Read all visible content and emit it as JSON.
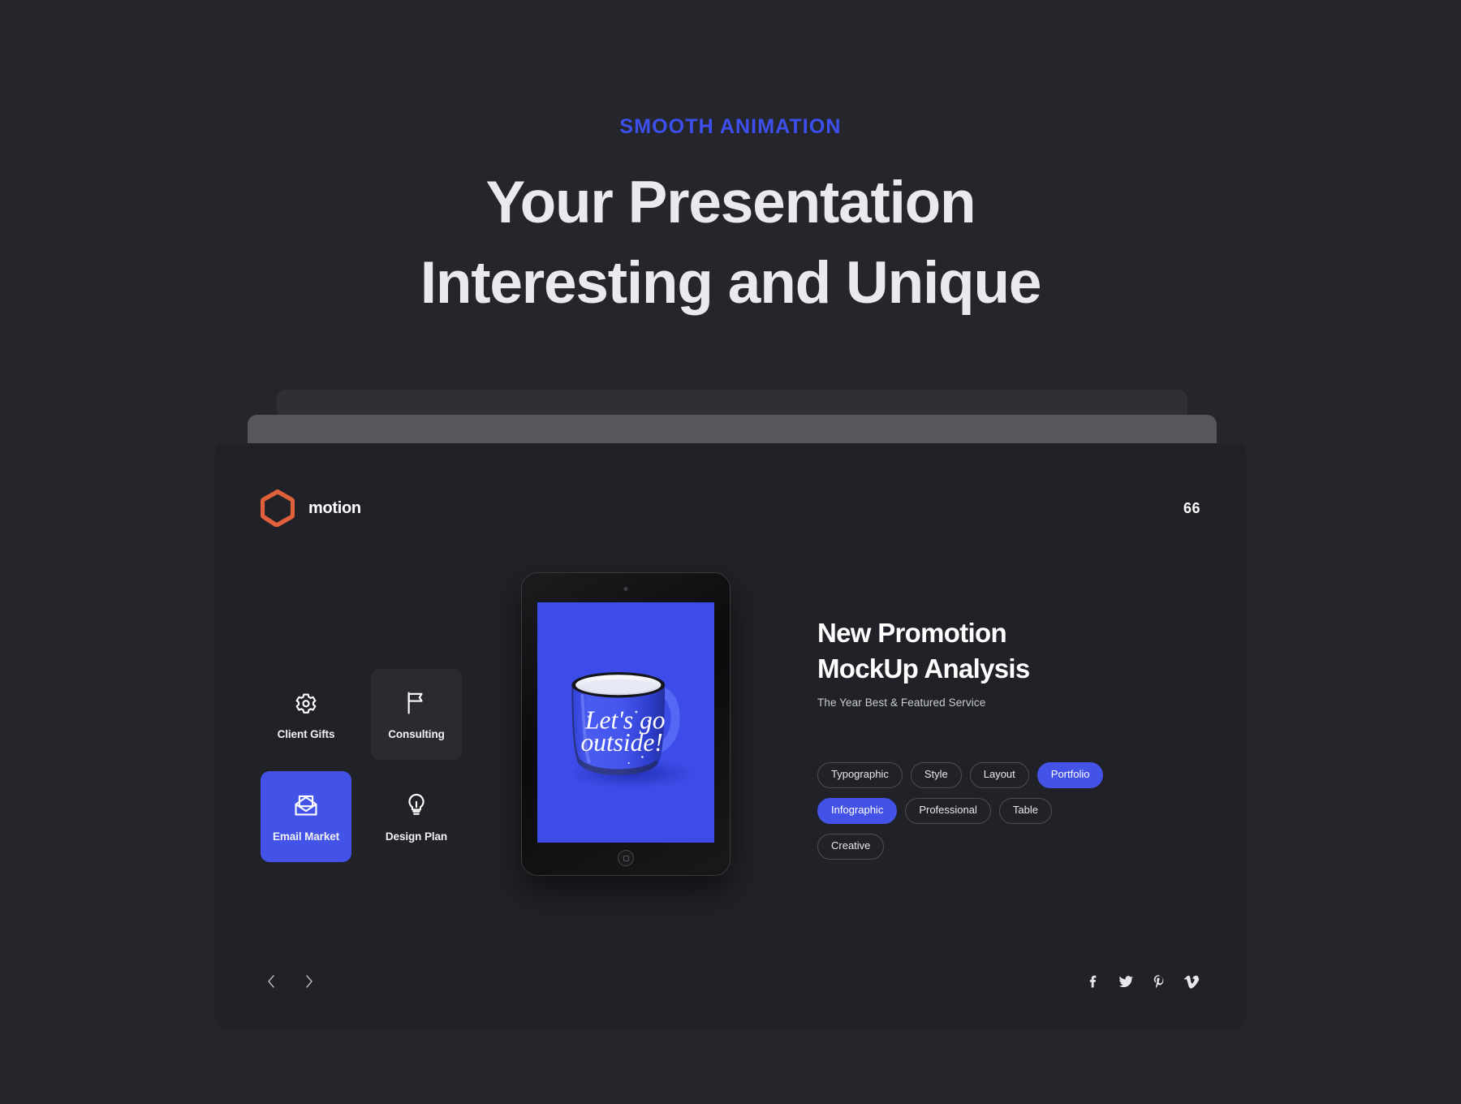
{
  "hero": {
    "eyebrow": "SMOOTH ANIMATION",
    "title_line1": "Your Presentation",
    "title_line2": "Interesting and Unique",
    "eyebrow_color": "#3d50ef"
  },
  "slide": {
    "brand_name": "motion",
    "logo_icon": "hexagon-outline-icon",
    "page_number": "66",
    "accent_color": "#4353e8",
    "background_color": "#212227",
    "tiles": [
      {
        "label": "Client Gifts",
        "icon": "gear-icon",
        "state": "default"
      },
      {
        "label": "Consulting",
        "icon": "flag-icon",
        "state": "soft"
      },
      {
        "label": "Email Market",
        "icon": "open-envelope-icon",
        "state": "active"
      },
      {
        "label": "Design Plan",
        "icon": "lightbulb-icon",
        "state": "default"
      }
    ],
    "device": {
      "type": "tablet-mockup",
      "screen_background": "#3d4ce8",
      "artwork": "blue-enamel-mug",
      "artwork_text_line1": "Let's go",
      "artwork_text_line2": "outside!"
    },
    "content": {
      "title_line1": "New Promotion",
      "title_line2": "MockUp Analysis",
      "subtitle": "The Year Best & Featured Service"
    },
    "tags": [
      {
        "label": "Typographic",
        "active": false
      },
      {
        "label": "Style",
        "active": false
      },
      {
        "label": "Layout",
        "active": false
      },
      {
        "label": "Portfolio",
        "active": true
      },
      {
        "label": "Infographic",
        "active": true
      },
      {
        "label": "Professional",
        "active": false
      },
      {
        "label": "Table",
        "active": false
      },
      {
        "label": "Creative",
        "active": false
      }
    ],
    "nav": {
      "prev_icon": "chevron-left-icon",
      "next_icon": "chevron-right-icon"
    },
    "socials": [
      {
        "name": "facebook-icon"
      },
      {
        "name": "twitter-icon"
      },
      {
        "name": "pinterest-icon"
      },
      {
        "name": "vimeo-icon"
      }
    ]
  }
}
